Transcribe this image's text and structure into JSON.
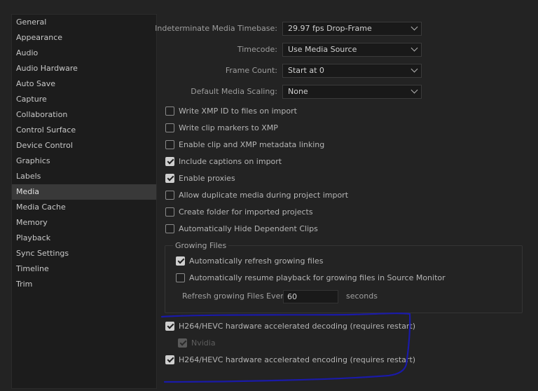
{
  "sidebar": {
    "items": [
      {
        "label": "General"
      },
      {
        "label": "Appearance"
      },
      {
        "label": "Audio"
      },
      {
        "label": "Audio Hardware"
      },
      {
        "label": "Auto Save"
      },
      {
        "label": "Capture"
      },
      {
        "label": "Collaboration"
      },
      {
        "label": "Control Surface"
      },
      {
        "label": "Device Control"
      },
      {
        "label": "Graphics"
      },
      {
        "label": "Labels"
      },
      {
        "label": "Media"
      },
      {
        "label": "Media Cache"
      },
      {
        "label": "Memory"
      },
      {
        "label": "Playback"
      },
      {
        "label": "Sync Settings"
      },
      {
        "label": "Timeline"
      },
      {
        "label": "Trim"
      }
    ],
    "selected": "Media"
  },
  "settings": {
    "timebase": {
      "label": "Indeterminate Media Timebase:",
      "value": "29.97 fps Drop-Frame"
    },
    "timecode": {
      "label": "Timecode:",
      "value": "Use Media Source"
    },
    "frame_count": {
      "label": "Frame Count:",
      "value": "Start at 0"
    },
    "scaling": {
      "label": "Default Media Scaling:",
      "value": "None"
    }
  },
  "checkboxes": {
    "xmp_id": {
      "label": "Write XMP ID to files on import",
      "checked": false
    },
    "clip_markers": {
      "label": "Write clip markers to XMP",
      "checked": false
    },
    "xmp_linking": {
      "label": "Enable clip and XMP metadata linking",
      "checked": false
    },
    "captions": {
      "label": "Include captions on import",
      "checked": true
    },
    "proxies": {
      "label": "Enable proxies",
      "checked": true
    },
    "duplicate_media": {
      "label": "Allow duplicate media during project import",
      "checked": false
    },
    "create_folder": {
      "label": "Create folder for imported projects",
      "checked": false
    },
    "hide_dependent": {
      "label": "Automatically Hide Dependent Clips",
      "checked": false
    },
    "hw_decoding": {
      "label": "H264/HEVC hardware accelerated decoding (requires restart)",
      "checked": true
    },
    "nvidia": {
      "label": "Nvidia",
      "checked": true,
      "disabled": true
    },
    "hw_encoding": {
      "label": "H264/HEVC hardware accelerated encoding (requires restart)",
      "checked": true
    }
  },
  "growing_files": {
    "title": "Growing Files",
    "auto_refresh": {
      "label": "Automatically refresh growing files",
      "checked": true
    },
    "auto_resume": {
      "label": "Automatically resume playback for growing files in Source Monitor",
      "checked": false
    },
    "refresh_label": "Refresh growing Files Every",
    "refresh_value": "60",
    "refresh_unit": "seconds"
  },
  "colors": {
    "background": "#232323",
    "sidebar_bg": "#1c1c1c",
    "selected_bg": "#393939",
    "annotation": "#1a1aa8"
  }
}
